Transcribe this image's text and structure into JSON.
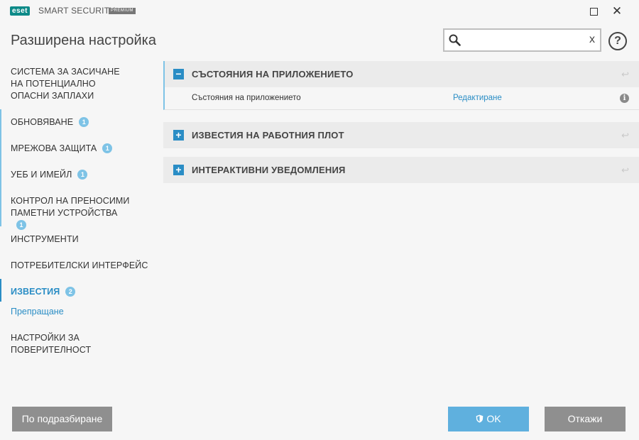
{
  "app": {
    "logo_text": "eset",
    "product_name": "SMART SECURITY",
    "product_edition": "PREMIUM"
  },
  "window": {
    "maximize_icon": "maximize-icon",
    "close_icon": "close-icon",
    "close_glyph": "✕"
  },
  "page": {
    "title": "Разширена настройка"
  },
  "search": {
    "value": "",
    "placeholder": "",
    "clear_glyph": "x"
  },
  "help": {
    "glyph": "?"
  },
  "sidebar": {
    "items": [
      {
        "label": "СИСТЕМА ЗА ЗАСИЧАНЕ НА ПОТЕНЦИАЛНО ОПАСНИ ЗАПЛАХИ",
        "badge": ""
      },
      {
        "label": "ОБНОВЯВАНЕ",
        "badge": "1"
      },
      {
        "label": "МРЕЖОВА ЗАЩИТА",
        "badge": "1"
      },
      {
        "label": "УЕБ И ИМЕЙЛ",
        "badge": "1"
      },
      {
        "label": "КОНТРОЛ НА ПРЕНОСИМИ ПАМЕТНИ УСТРОЙСТВА",
        "badge": "1"
      },
      {
        "label": "ИНСТРУМЕНТИ",
        "badge": ""
      },
      {
        "label": "ПОТРЕБИТЕЛСКИ ИНТЕРФЕЙС",
        "badge": ""
      },
      {
        "label": "ИЗВЕСТИЯ",
        "badge": "2",
        "active": true
      },
      {
        "label": "НАСТРОЙКИ ЗА ПОВЕРИТЕЛНОСТ",
        "badge": ""
      }
    ],
    "sub_items": [
      {
        "label": "Препращане"
      }
    ]
  },
  "main": {
    "sections": [
      {
        "title": "СЪСТОЯНИЯ НА ПРИЛОЖЕНИЕТО",
        "expanded": true,
        "toggle_glyph": "−",
        "rows": [
          {
            "label": "Състояния на приложението",
            "link": "Редактиране",
            "info_glyph": "i"
          }
        ]
      },
      {
        "title": "ИЗВЕСТИЯ НА РАБОТНИЯ ПЛОТ",
        "expanded": false,
        "toggle_glyph": "+"
      },
      {
        "title": "ИНТЕРАКТИВНИ УВЕДОМЛЕНИЯ",
        "expanded": false,
        "toggle_glyph": "+"
      }
    ],
    "reset_glyph": "↩"
  },
  "footer": {
    "default_label": "По подразбиране",
    "ok_label": "OK",
    "cancel_label": "Откажи"
  },
  "colors": {
    "accent": "#2a8dc5",
    "accent_light": "#7ec3e6",
    "brand": "#0d8a88",
    "button_gray": "#8f8f8f"
  }
}
